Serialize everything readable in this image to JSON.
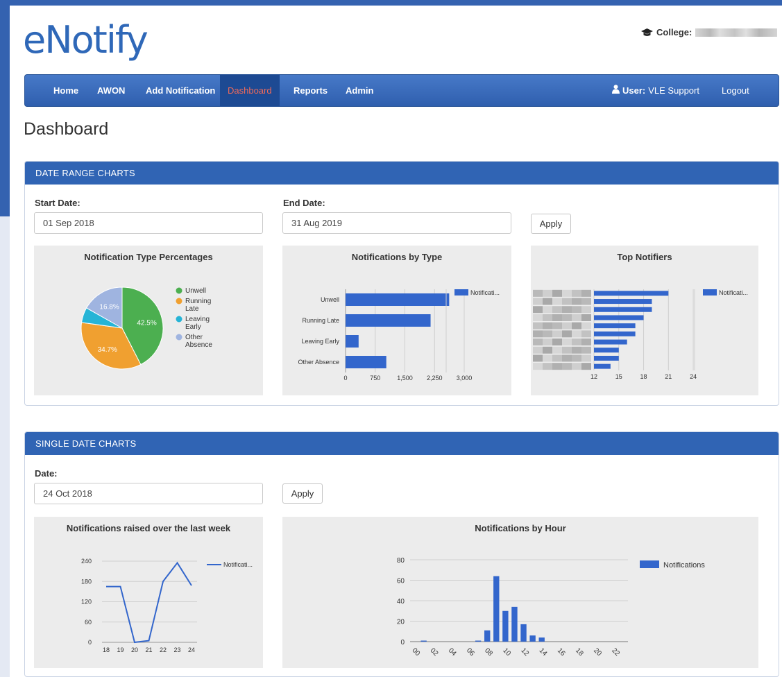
{
  "app": {
    "logo": "eNotify",
    "college_label": "College:"
  },
  "nav": {
    "home": "Home",
    "awon": "AWON",
    "add_notification": "Add Notification",
    "dashboard": "Dashboard",
    "reports": "Reports",
    "admin": "Admin",
    "user_label": "User:",
    "user_name": "VLE Support",
    "logout": "Logout"
  },
  "page_title": "Dashboard",
  "date_range": {
    "header": "DATE RANGE CHARTS",
    "start_label": "Start Date:",
    "start_value": "01 Sep 2018",
    "end_label": "End Date:",
    "end_value": "31 Aug 2019",
    "apply": "Apply"
  },
  "single_date": {
    "header": "SINGLE DATE CHARTS",
    "date_label": "Date:",
    "date_value": "24 Oct 2018",
    "apply": "Apply"
  },
  "colors": {
    "brand": "#3064b4",
    "bar": "#3366cc",
    "pie": [
      "#4caf50",
      "#f0a030",
      "#26b4d6",
      "#9fb4e0"
    ],
    "active_nav_text": "#ef6a5a"
  },
  "chart_data": [
    {
      "type": "pie",
      "title": "Notification Type Percentages",
      "labels": [
        "Unwell",
        "Running Late",
        "Leaving Early",
        "Other Absence"
      ],
      "values": [
        42.5,
        34.7,
        6.0,
        16.8
      ],
      "slice_labels": [
        "42.5%",
        "34.7%",
        "",
        "16.8%"
      ],
      "legend": [
        {
          "l1": "Unwell",
          "l2": ""
        },
        {
          "l1": "Running",
          "l2": "Late"
        },
        {
          "l1": "Leaving",
          "l2": "Early"
        },
        {
          "l1": "Other",
          "l2": "Absence"
        }
      ],
      "legend_position": "right"
    },
    {
      "type": "bar",
      "orientation": "horizontal",
      "title": "Notifications by Type",
      "categories": [
        "Unwell",
        "Running Late",
        "Leaving Early",
        "Other Absence"
      ],
      "values": [
        2620,
        2150,
        330,
        1030
      ],
      "xlim": [
        0,
        3000
      ],
      "ticks": [
        "0",
        "750",
        "1,500",
        "2,250",
        "3,000"
      ],
      "series_name": "Notificati...",
      "legend_position": "right"
    },
    {
      "type": "bar",
      "orientation": "horizontal",
      "title": "Top Notifiers",
      "values": [
        21,
        19,
        19,
        18,
        17,
        17,
        16,
        15,
        15,
        14
      ],
      "xlim": [
        12,
        25
      ],
      "ticks": [
        "12",
        "15",
        "18",
        "21",
        "24"
      ],
      "series_name": "Notificati...",
      "legend_position": "right"
    },
    {
      "type": "line",
      "title": "Notifications raised over the last week",
      "x": [
        "18",
        "19",
        "20",
        "21",
        "22",
        "23",
        "24"
      ],
      "values": [
        165,
        165,
        0,
        5,
        180,
        235,
        168
      ],
      "ylim": [
        0,
        240
      ],
      "yticks": [
        "0",
        "60",
        "120",
        "180",
        "240"
      ],
      "series_name": "Notificati...",
      "legend_position": "right"
    },
    {
      "type": "bar",
      "title": "Notifications by Hour",
      "values": [
        0,
        1,
        0,
        0,
        0,
        0,
        0,
        1,
        11,
        64,
        30,
        34,
        17,
        6,
        4,
        0,
        0,
        0,
        0,
        0,
        0,
        0,
        0,
        0
      ],
      "ylim": [
        0,
        80
      ],
      "yticks": [
        "0",
        "20",
        "40",
        "60",
        "80"
      ],
      "xticks": [
        "00",
        "02",
        "04",
        "06",
        "08",
        "10",
        "12",
        "14",
        "16",
        "18",
        "20",
        "22"
      ],
      "series_name": "Notifications",
      "legend_position": "right"
    }
  ]
}
